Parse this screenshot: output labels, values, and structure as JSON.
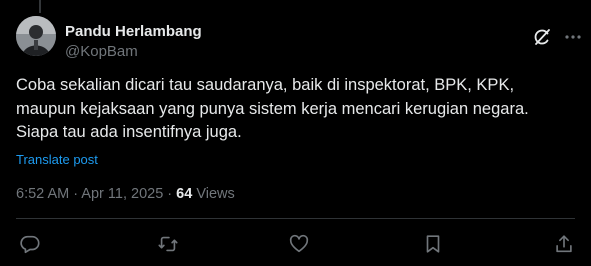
{
  "author": {
    "name": "Pandu Herlambang",
    "handle": "@KopBam",
    "avatar_icon": "avatar-photo"
  },
  "header_icons": {
    "grok": "grok-icon",
    "more": "more-icon"
  },
  "tweet": {
    "lines": [
      "Coba sekalian dicari tau saudaranya, baik di inspektorat, BPK, KPK,",
      "maupun kejaksaan yang punya sistem kerja mencari kerugian negara.",
      "Siapa tau ada insentifnya juga."
    ],
    "translate_label": "Translate post"
  },
  "meta": {
    "time": "6:52 AM",
    "separator": " · ",
    "date": "Apr 11, 2025",
    "views_count": "64",
    "views_label": " Views"
  },
  "actions": [
    "reply-icon",
    "repost-icon",
    "like-icon",
    "bookmark-icon",
    "share-icon"
  ],
  "colors": {
    "background": "#000000",
    "text": "#e7e9ea",
    "secondary": "#71767b",
    "accent": "#1d9bf0",
    "divider": "#2f3336"
  }
}
